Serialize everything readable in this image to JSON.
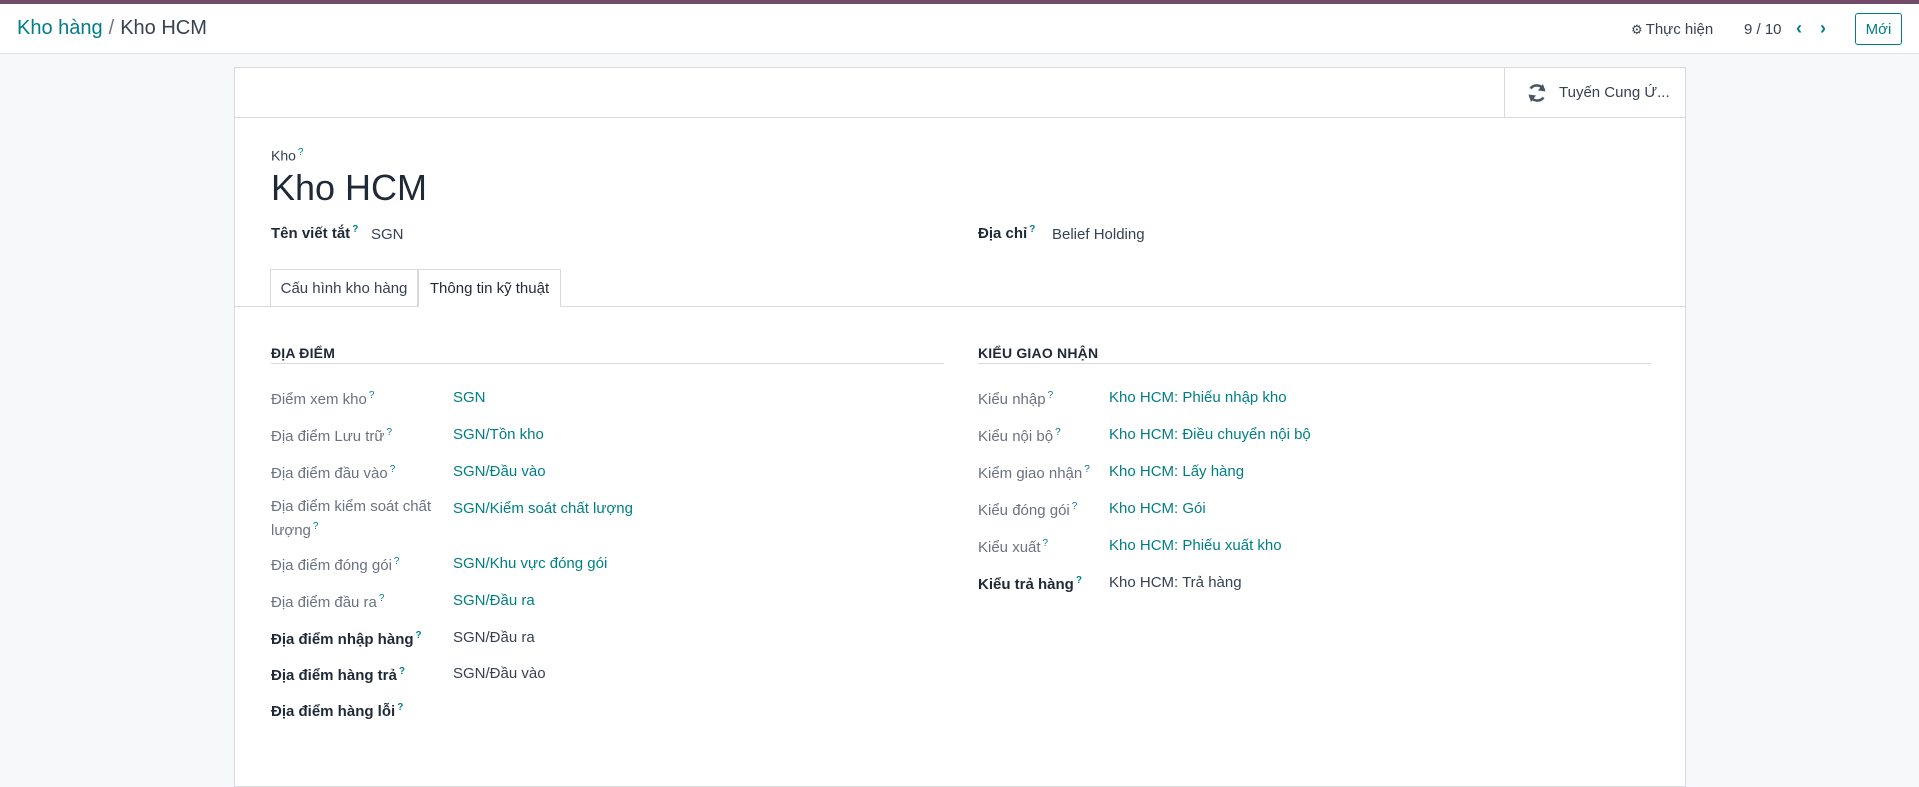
{
  "header": {
    "breadcrumb_parent": "Kho hàng",
    "breadcrumb_separator": "/",
    "breadcrumb_current": "Kho HCM",
    "action_label": "Thực hiện",
    "action_icon": "gear-icon",
    "pager_value": "9 / 10",
    "new_button": "Mới"
  },
  "smart_button": {
    "label": "Tuyến Cung Ứ...",
    "icon": "refresh-icon"
  },
  "record": {
    "title_label": "Kho",
    "help_mark": "?",
    "name": "Kho HCM",
    "short_name_label": "Tên viết tắt",
    "short_name_value": "SGN",
    "address_label": "Địa chỉ",
    "address_value": "Belief Holding"
  },
  "tabs": [
    {
      "label": "Cấu hình kho hàng",
      "active": false
    },
    {
      "label": "Thông tin kỹ thuật",
      "active": true
    }
  ],
  "locations": {
    "title": "ĐỊA ĐIỂM",
    "rows": [
      {
        "label": "Điểm xem kho",
        "value": "SGN"
      },
      {
        "label": "Địa điểm Lưu trữ",
        "value": "SGN/Tồn kho"
      },
      {
        "label": "Địa điểm đầu vào",
        "value": "SGN/Đầu vào"
      },
      {
        "label": "Địa điểm kiểm soát chất",
        "label_line2": "lượng",
        "value": "SGN/Kiểm soát chất lượng"
      },
      {
        "label": "Địa điểm đóng gói",
        "value": "SGN/Khu vực đóng gói"
      },
      {
        "label": "Địa điểm đầu ra",
        "value": "SGN/Đầu ra"
      },
      {
        "label": "Địa điểm nhập hàng",
        "value": "SGN/Đầu ra"
      },
      {
        "label": "Địa điểm hàng trả",
        "value": "SGN/Đầu vào"
      },
      {
        "label": "Địa điểm hàng lỗi",
        "value": ""
      }
    ]
  },
  "operation_types": {
    "title": "KIỂU GIAO NHẬN",
    "rows": [
      {
        "label": "Kiểu nhập",
        "value": "Kho HCM: Phiếu nhập kho"
      },
      {
        "label": "Kiểu nội bộ",
        "value": "Kho HCM: Điều chuyển nội bộ"
      },
      {
        "label": "Kiểm giao nhận",
        "value": "Kho HCM: Lấy hàng"
      },
      {
        "label": "Kiểu đóng gói",
        "value": "Kho HCM: Gói"
      },
      {
        "label": "Kiểu xuất",
        "value": "Kho HCM: Phiếu xuất kho"
      },
      {
        "label": "Kiểu trả hàng",
        "value": "Kho HCM: Trả hàng"
      }
    ]
  },
  "colors": {
    "brand_bar": "#714b67",
    "link": "#017e84"
  }
}
